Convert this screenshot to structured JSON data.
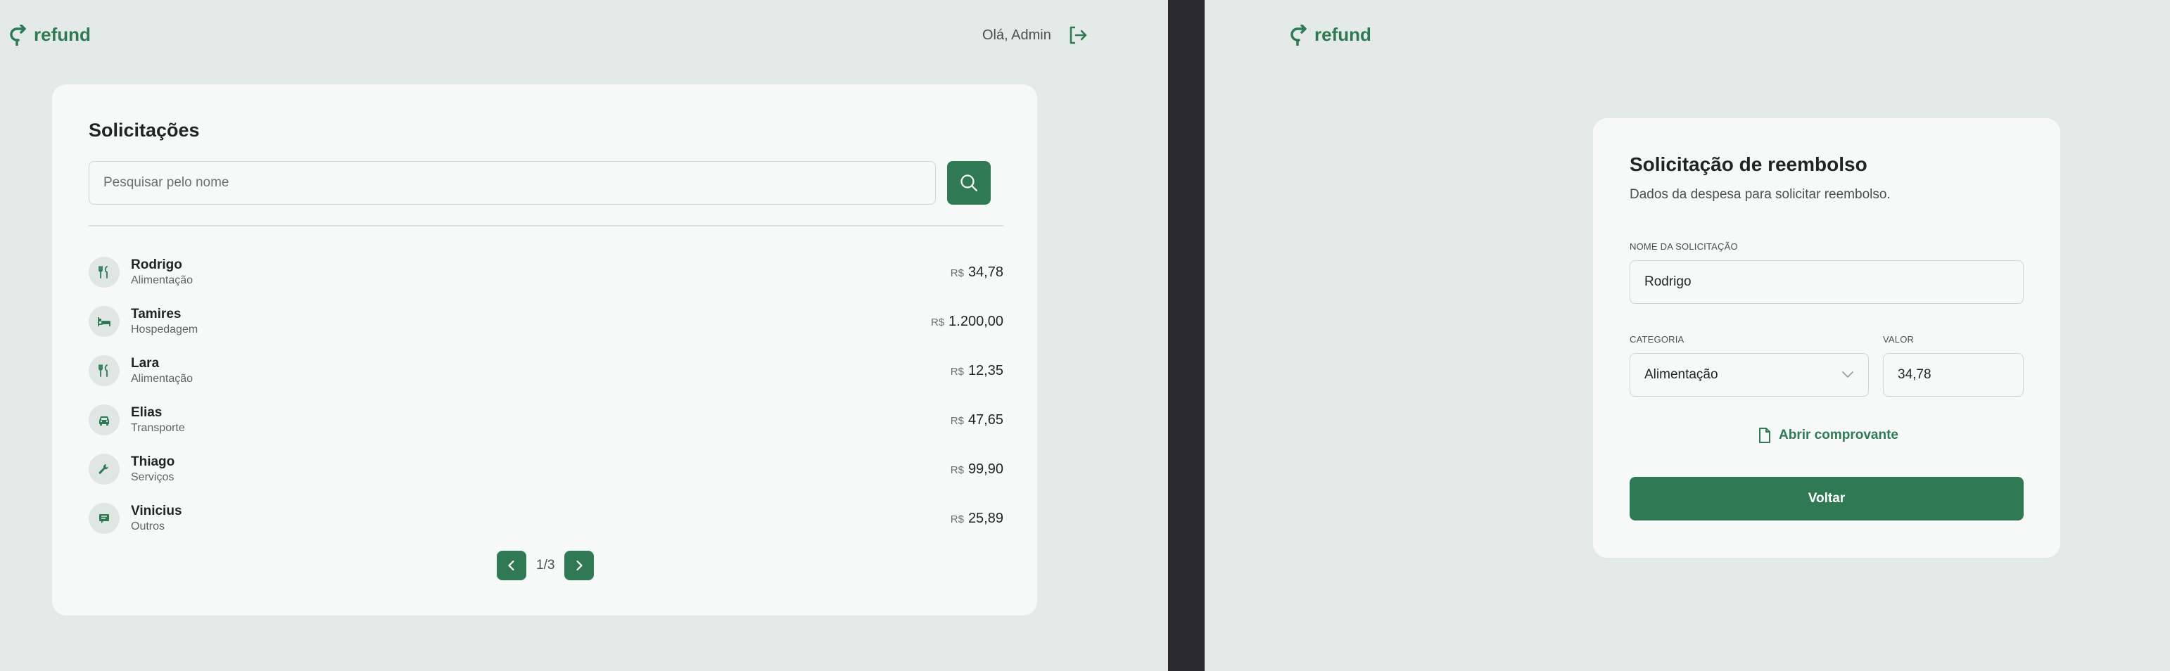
{
  "left_screen": {
    "logo_text": "refund",
    "greeting": "Olá, Admin",
    "title": "Solicitações",
    "search": {
      "placeholder": "Pesquisar pelo nome",
      "value": ""
    },
    "requests": [
      {
        "name": "Rodrigo",
        "category": "Alimentação",
        "currency": "R$",
        "value": "34,78",
        "icon": "fork-knife-icon"
      },
      {
        "name": "Tamires",
        "category": "Hospedagem",
        "currency": "R$",
        "value": "1.200,00",
        "icon": "bed-icon"
      },
      {
        "name": "Lara",
        "category": "Alimentação",
        "currency": "R$",
        "value": "12,35",
        "icon": "fork-knife-icon"
      },
      {
        "name": "Elias",
        "category": "Transporte",
        "currency": "R$",
        "value": "47,65",
        "icon": "car-icon"
      },
      {
        "name": "Thiago",
        "category": "Serviços",
        "currency": "R$",
        "value": "99,90",
        "icon": "wrench-icon"
      },
      {
        "name": "Vinicius",
        "category": "Outros",
        "currency": "R$",
        "value": "25,89",
        "icon": "receipt-icon"
      }
    ],
    "pagination": {
      "label": "1/3"
    }
  },
  "right_screen": {
    "logo_text": "refund",
    "title": "Solicitação de reembolso",
    "subtitle": "Dados da despesa para solicitar reembolso.",
    "name_label": "NOME DA SOLICITAÇÃO",
    "name_value": "Rodrigo",
    "category_label": "CATEGORIA",
    "category_value": "Alimentação",
    "amount_label": "VALOR",
    "amount_value": "34,78",
    "receipt_link": "Abrir comprovante",
    "back_button": "Voltar"
  },
  "colors": {
    "brand": "#2f7a55",
    "background": "#e3eae7",
    "card": "#f7f8f8",
    "divider_bar": "#2b2a2e"
  }
}
